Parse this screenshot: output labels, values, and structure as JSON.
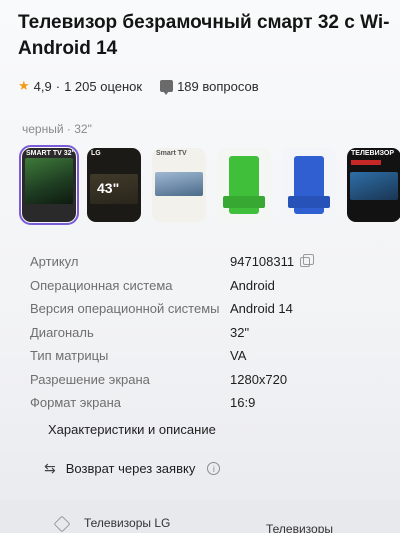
{
  "product": {
    "title_line1": "Телевизор безрамочный смарт 32 с Wi-",
    "title_line2": "Android 14",
    "rating": "4,9",
    "reviews": "1 205 оценок",
    "questions": "189 вопросов",
    "rating_separator": "·"
  },
  "variant": {
    "label": "черный · 32\""
  },
  "thumbnails": [
    {
      "label": "SMART TV 32\"",
      "big": "",
      "selected": true
    },
    {
      "label": "LG",
      "big": "43\"",
      "selected": false
    },
    {
      "label": "Smart TV",
      "big": "",
      "selected": false
    },
    {
      "label": "",
      "big": "",
      "selected": false
    },
    {
      "label": "",
      "big": "",
      "selected": false
    },
    {
      "label": "ТЕЛЕВИЗОР",
      "big": "",
      "selected": false
    }
  ],
  "specs": [
    {
      "key": "Артикул",
      "value": "947108311"
    },
    {
      "key": "Операционная система",
      "value": "Android"
    },
    {
      "key": "Версия операционной системы",
      "value": "Android 14"
    },
    {
      "key": "Диагональ",
      "value": "32\""
    },
    {
      "key": "Тип матрицы",
      "value": "VA"
    },
    {
      "key": "Разрешение экрана",
      "value": "1280x720"
    },
    {
      "key": "Формат экрана",
      "value": "16:9"
    }
  ],
  "links": {
    "characteristics": "Характеристики и описание",
    "return": "Возврат через заявку"
  },
  "bottom": {
    "category1": "Телевизоры LG",
    "category2": "Телевизоры"
  },
  "icons": {
    "star": "star-icon",
    "question": "question-icon",
    "copy": "copy-icon",
    "return": "return-icon",
    "info": "info-icon",
    "tag": "tag-icon"
  },
  "colors": {
    "star": "#f29b17",
    "selected_outline": "#7b5bd6"
  }
}
